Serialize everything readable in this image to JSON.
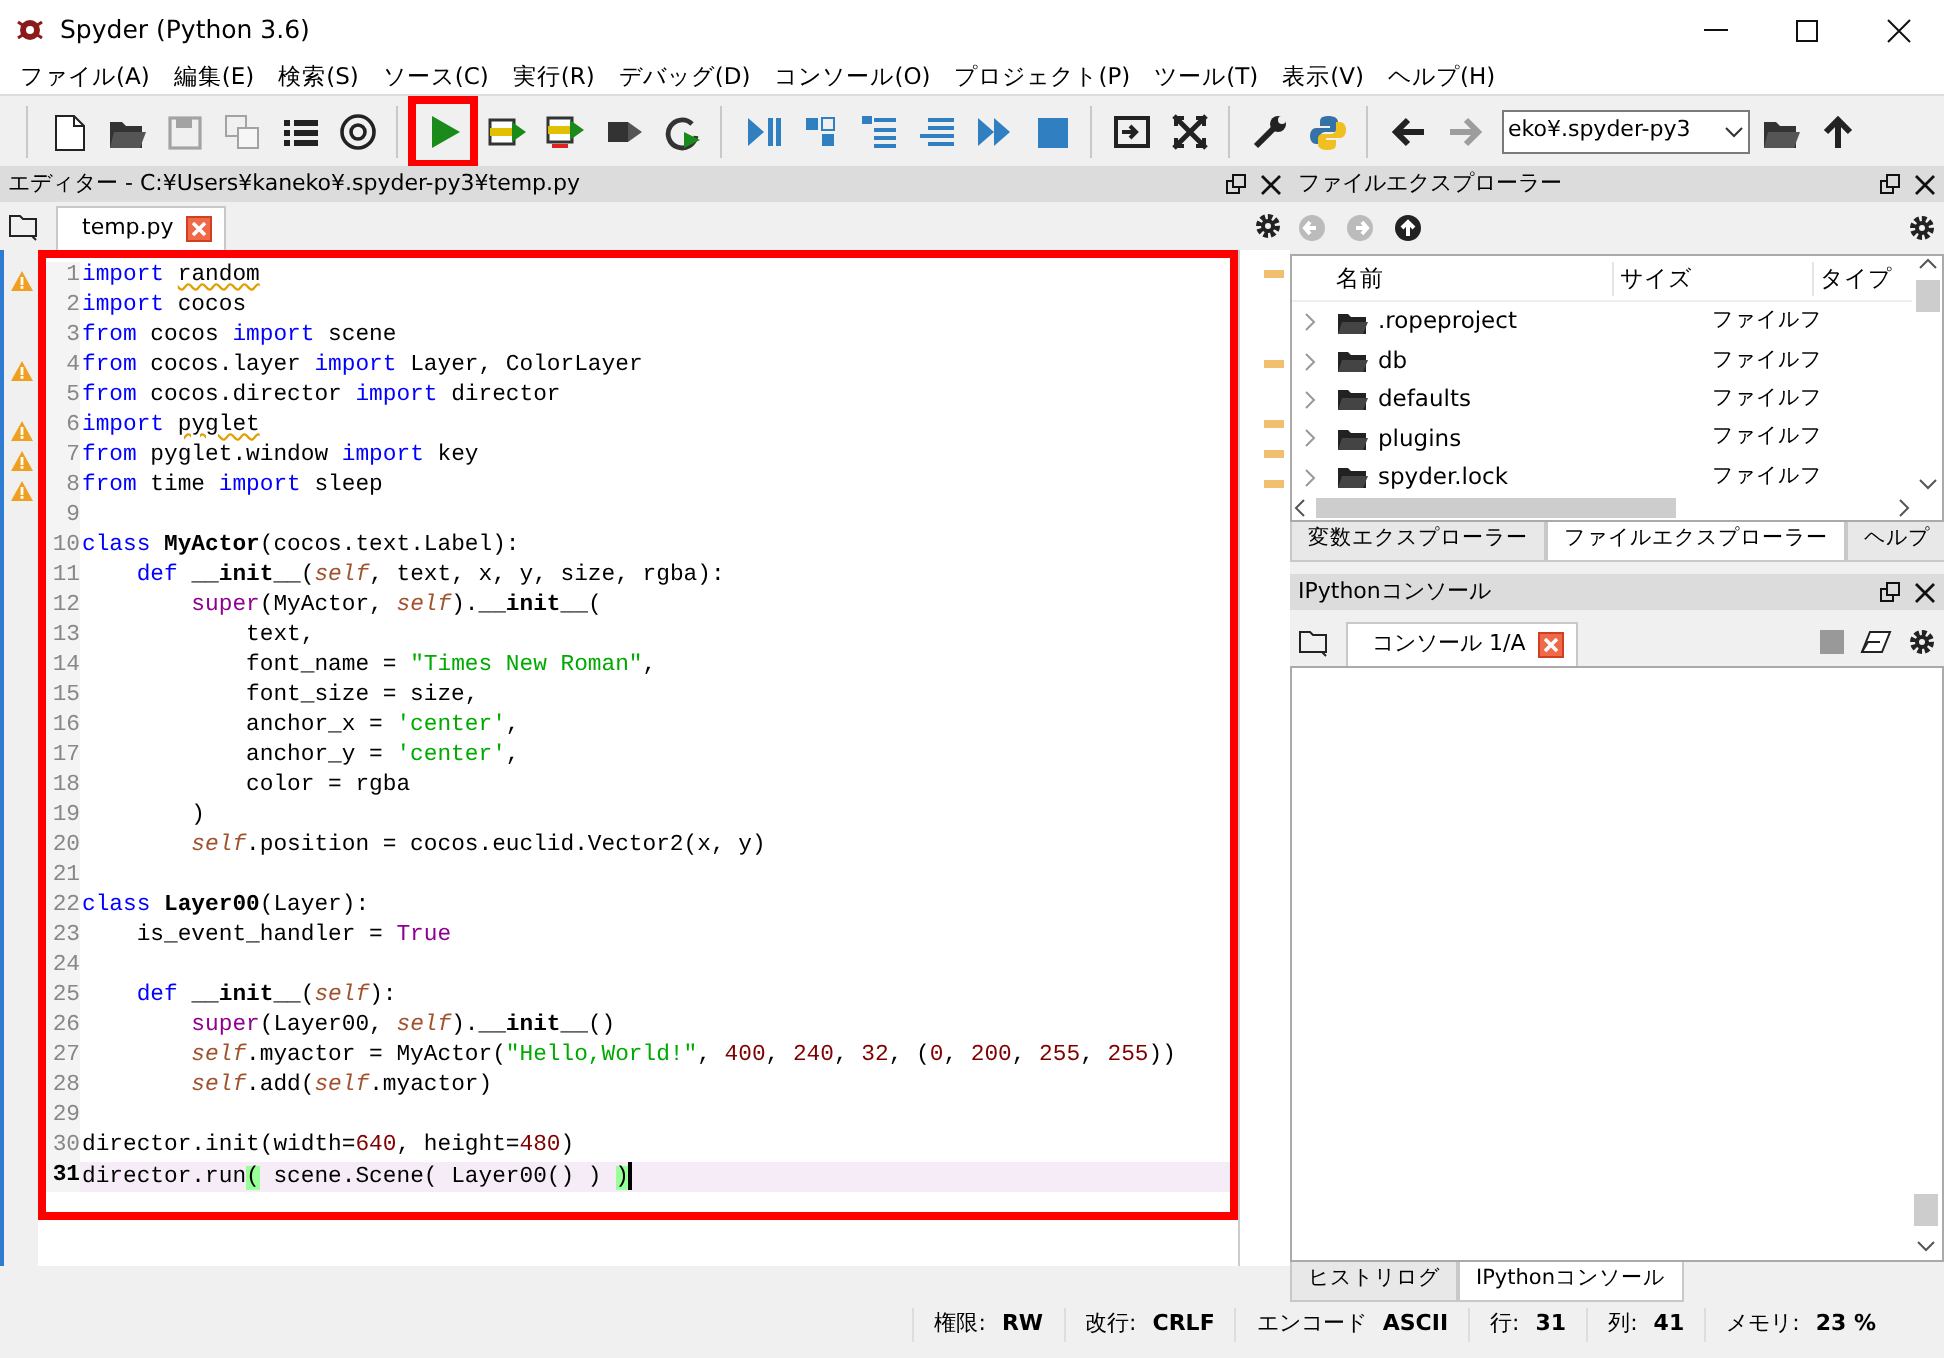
{
  "window": {
    "title": "Spyder (Python 3.6)"
  },
  "menu": [
    "ファイル(A)",
    "編集(E)",
    "検索(S)",
    "ソース(C)",
    "実行(R)",
    "デバッグ(D)",
    "コンソール(O)",
    "プロジェクト(P)",
    "ツール(T)",
    "表示(V)",
    "ヘルプ(H)"
  ],
  "toolbar": [
    [
      {
        "kind": "new-file",
        "disabled": false,
        "highlighted": false
      },
      {
        "kind": "open",
        "disabled": false,
        "highlighted": false
      },
      {
        "kind": "save",
        "disabled": true,
        "highlighted": false
      },
      {
        "kind": "save-all",
        "disabled": true,
        "highlighted": false
      },
      {
        "kind": "list",
        "disabled": false,
        "highlighted": false
      },
      {
        "kind": "at",
        "disabled": false,
        "highlighted": false
      }
    ],
    [
      {
        "kind": "run",
        "disabled": false,
        "highlighted": true
      },
      {
        "kind": "run-cell",
        "disabled": false,
        "highlighted": false
      },
      {
        "kind": "run-cell-advance",
        "disabled": false,
        "highlighted": false
      },
      {
        "kind": "run-selection",
        "disabled": false,
        "highlighted": false
      },
      {
        "kind": "rerun",
        "disabled": false,
        "highlighted": false
      }
    ],
    [
      {
        "kind": "debug",
        "disabled": false,
        "highlighted": false
      },
      {
        "kind": "step",
        "disabled": false,
        "highlighted": false
      },
      {
        "kind": "step-into",
        "disabled": false,
        "highlighted": false
      },
      {
        "kind": "step-return",
        "disabled": false,
        "highlighted": false
      },
      {
        "kind": "continue",
        "disabled": false,
        "highlighted": false
      },
      {
        "kind": "stop",
        "disabled": false,
        "highlighted": false
      }
    ],
    [
      {
        "kind": "maximize-pane",
        "disabled": false,
        "highlighted": false
      },
      {
        "kind": "fullscreen",
        "disabled": false,
        "highlighted": false
      }
    ],
    [
      {
        "kind": "wrench",
        "disabled": false,
        "highlighted": false
      },
      {
        "kind": "python",
        "disabled": false,
        "highlighted": false
      }
    ],
    [
      {
        "kind": "back",
        "disabled": false,
        "highlighted": false
      },
      {
        "kind": "forward",
        "disabled": true,
        "highlighted": false
      }
    ]
  ],
  "working_dir": {
    "value": "eko¥.spyder-py3"
  },
  "editor": {
    "title": "エディター - C:¥Users¥kaneko¥.spyder-py3¥temp.py",
    "tabs": [
      {
        "label": "temp.py",
        "selected": true
      }
    ],
    "highlighted": true,
    "lines": [
      {
        "number": "1",
        "warning": true,
        "current": false,
        "tokens": [
          {
            "kind": "keyword",
            "text": "import "
          },
          {
            "kind": "squiggle",
            "text": "random"
          }
        ]
      },
      {
        "number": "2",
        "warning": false,
        "current": false,
        "tokens": [
          {
            "kind": "keyword",
            "text": "import"
          },
          {
            "kind": "plain",
            "text": " cocos"
          }
        ]
      },
      {
        "number": "3",
        "warning": false,
        "current": false,
        "tokens": [
          {
            "kind": "keyword",
            "text": "from"
          },
          {
            "kind": "plain",
            "text": " cocos "
          },
          {
            "kind": "keyword",
            "text": "import"
          },
          {
            "kind": "plain",
            "text": " scene"
          }
        ]
      },
      {
        "number": "4",
        "warning": true,
        "current": false,
        "tokens": [
          {
            "kind": "keyword",
            "text": "from"
          },
          {
            "kind": "plain",
            "text": " cocos.layer "
          },
          {
            "kind": "keyword",
            "text": "import"
          },
          {
            "kind": "plain",
            "text": " Layer, ColorLayer"
          }
        ]
      },
      {
        "number": "5",
        "warning": false,
        "current": false,
        "tokens": [
          {
            "kind": "keyword",
            "text": "from"
          },
          {
            "kind": "plain",
            "text": " cocos.director "
          },
          {
            "kind": "keyword",
            "text": "import"
          },
          {
            "kind": "plain",
            "text": " director"
          }
        ]
      },
      {
        "number": "6",
        "warning": true,
        "current": false,
        "tokens": [
          {
            "kind": "keyword",
            "text": "import "
          },
          {
            "kind": "squiggle",
            "text": "pyglet"
          }
        ]
      },
      {
        "number": "7",
        "warning": true,
        "current": false,
        "tokens": [
          {
            "kind": "keyword",
            "text": "from"
          },
          {
            "kind": "plain",
            "text": " pyglet.window "
          },
          {
            "kind": "keyword",
            "text": "import"
          },
          {
            "kind": "plain",
            "text": " key"
          }
        ]
      },
      {
        "number": "8",
        "warning": true,
        "current": false,
        "tokens": [
          {
            "kind": "keyword",
            "text": "from"
          },
          {
            "kind": "plain",
            "text": " time "
          },
          {
            "kind": "keyword",
            "text": "import"
          },
          {
            "kind": "plain",
            "text": " sleep"
          }
        ]
      },
      {
        "number": "9",
        "warning": false,
        "current": false
      },
      {
        "number": "10",
        "warning": false,
        "current": false,
        "tokens": [
          {
            "kind": "keyword",
            "text": "class "
          },
          {
            "kind": "defname",
            "text": "MyActor"
          },
          {
            "kind": "plain",
            "text": "(cocos.text.Label):"
          }
        ]
      },
      {
        "number": "11",
        "warning": false,
        "current": false,
        "tokens": [
          {
            "kind": "keyword",
            "text": "    def "
          },
          {
            "kind": "defname",
            "text": "__init__"
          },
          {
            "kind": "plain",
            "text": "("
          },
          {
            "kind": "self",
            "text": "self"
          },
          {
            "kind": "plain",
            "text": ", text, x, y, size, rgba):"
          }
        ]
      },
      {
        "number": "12",
        "warning": false,
        "current": false,
        "tokens": [
          {
            "kind": "builtin",
            "text": "        super"
          },
          {
            "kind": "plain",
            "text": "(MyActor, "
          },
          {
            "kind": "self",
            "text": "self"
          },
          {
            "kind": "plain",
            "text": ")."
          },
          {
            "kind": "defname",
            "text": "__init__"
          },
          {
            "kind": "plain",
            "text": "("
          }
        ]
      },
      {
        "number": "13",
        "warning": false,
        "current": false,
        "tokens": [
          {
            "kind": "plain",
            "text": "            text,"
          }
        ]
      },
      {
        "number": "14",
        "warning": false,
        "current": false,
        "tokens": [
          {
            "kind": "plain",
            "text": "            font_name = "
          },
          {
            "kind": "string",
            "text": "\"Times New Roman\""
          },
          {
            "kind": "plain",
            "text": ","
          }
        ]
      },
      {
        "number": "15",
        "warning": false,
        "current": false,
        "tokens": [
          {
            "kind": "plain",
            "text": "            font_size = size,"
          }
        ]
      },
      {
        "number": "16",
        "warning": false,
        "current": false,
        "tokens": [
          {
            "kind": "plain",
            "text": "            anchor_x = "
          },
          {
            "kind": "string",
            "text": "'center'"
          },
          {
            "kind": "plain",
            "text": ","
          }
        ]
      },
      {
        "number": "17",
        "warning": false,
        "current": false,
        "tokens": [
          {
            "kind": "plain",
            "text": "            anchor_y = "
          },
          {
            "kind": "string",
            "text": "'center'"
          },
          {
            "kind": "plain",
            "text": ","
          }
        ]
      },
      {
        "number": "18",
        "warning": false,
        "current": false,
        "tokens": [
          {
            "kind": "plain",
            "text": "            color = rgba"
          }
        ]
      },
      {
        "number": "19",
        "warning": false,
        "current": false,
        "tokens": [
          {
            "kind": "plain",
            "text": "        )"
          }
        ]
      },
      {
        "number": "20",
        "warning": false,
        "current": false,
        "tokens": [
          {
            "kind": "self",
            "text": "        self"
          },
          {
            "kind": "plain",
            "text": ".position = cocos.euclid.Vector2(x, y)"
          }
        ]
      },
      {
        "number": "21",
        "warning": false,
        "current": false
      },
      {
        "number": "22",
        "warning": false,
        "current": false,
        "tokens": [
          {
            "kind": "keyword",
            "text": "class "
          },
          {
            "kind": "defname",
            "text": "Layer00"
          },
          {
            "kind": "plain",
            "text": "(Layer):"
          }
        ]
      },
      {
        "number": "23",
        "warning": false,
        "current": false,
        "tokens": [
          {
            "kind": "plain",
            "text": "    is_event_handler = "
          },
          {
            "kind": "builtin",
            "text": "True"
          }
        ]
      },
      {
        "number": "24",
        "warning": false,
        "current": false
      },
      {
        "number": "25",
        "warning": false,
        "current": false,
        "tokens": [
          {
            "kind": "keyword",
            "text": "    def "
          },
          {
            "kind": "defname",
            "text": "__init__"
          },
          {
            "kind": "plain",
            "text": "("
          },
          {
            "kind": "self",
            "text": "self"
          },
          {
            "kind": "plain",
            "text": "):"
          }
        ]
      },
      {
        "number": "26",
        "warning": false,
        "current": false,
        "tokens": [
          {
            "kind": "builtin",
            "text": "        super"
          },
          {
            "kind": "plain",
            "text": "(Layer00, "
          },
          {
            "kind": "self",
            "text": "self"
          },
          {
            "kind": "plain",
            "text": ")."
          },
          {
            "kind": "defname",
            "text": "__init__"
          },
          {
            "kind": "plain",
            "text": "()"
          }
        ]
      },
      {
        "number": "27",
        "warning": false,
        "current": false,
        "tokens": [
          {
            "kind": "self",
            "text": "        self"
          },
          {
            "kind": "plain",
            "text": ".myactor = MyActor("
          },
          {
            "kind": "string",
            "text": "\"Hello,World!\""
          },
          {
            "kind": "plain",
            "text": ", "
          },
          {
            "kind": "number",
            "text": "400"
          },
          {
            "kind": "plain",
            "text": ", "
          },
          {
            "kind": "number",
            "text": "240"
          },
          {
            "kind": "plain",
            "text": ", "
          },
          {
            "kind": "number",
            "text": "32"
          },
          {
            "kind": "plain",
            "text": ", ("
          },
          {
            "kind": "number",
            "text": "0"
          },
          {
            "kind": "plain",
            "text": ", "
          },
          {
            "kind": "number",
            "text": "200"
          },
          {
            "kind": "plain",
            "text": ", "
          },
          {
            "kind": "number",
            "text": "255"
          },
          {
            "kind": "plain",
            "text": ", "
          },
          {
            "kind": "number",
            "text": "255"
          },
          {
            "kind": "plain",
            "text": "))"
          }
        ]
      },
      {
        "number": "28",
        "warning": false,
        "current": false,
        "tokens": [
          {
            "kind": "self",
            "text": "        self"
          },
          {
            "kind": "plain",
            "text": ".add("
          },
          {
            "kind": "self",
            "text": "self"
          },
          {
            "kind": "plain",
            "text": ".myactor)"
          }
        ]
      },
      {
        "number": "29",
        "warning": false,
        "current": false
      },
      {
        "number": "30",
        "warning": false,
        "current": false,
        "tokens": [
          {
            "kind": "plain",
            "text": "director.init(width="
          },
          {
            "kind": "number",
            "text": "640"
          },
          {
            "kind": "plain",
            "text": ", height="
          },
          {
            "kind": "number",
            "text": "480"
          },
          {
            "kind": "plain",
            "text": ")"
          }
        ]
      },
      {
        "number": "31",
        "warning": false,
        "current": true,
        "tokens": [
          {
            "kind": "plain",
            "text": "director.run"
          },
          {
            "kind": "match",
            "text": "("
          },
          {
            "kind": "plain",
            "text": " scene.Scene( Layer00() ) "
          },
          {
            "kind": "match",
            "text": ")"
          }
        ]
      }
    ]
  },
  "file_explorer": {
    "title": "ファイルエクスプローラー",
    "columns": [
      "名前",
      "サイズ",
      "タイプ"
    ],
    "rows": [
      {
        "name": ".ropeproject",
        "type": "ファイルフ"
      },
      {
        "name": "db",
        "type": "ファイルフ"
      },
      {
        "name": "defaults",
        "type": "ファイルフ"
      },
      {
        "name": "plugins",
        "type": "ファイルフ"
      },
      {
        "name": "spyder.lock",
        "type": "ファイルフ"
      }
    ]
  },
  "upper_tabs": [
    {
      "label": "変数エクスプローラー",
      "selected": false
    },
    {
      "label": "ファイルエクスプローラー",
      "selected": true
    },
    {
      "label": "ヘルプ",
      "selected": false
    }
  ],
  "console": {
    "title": "IPythonコンソール",
    "tabs": [
      {
        "label": "コンソール 1/A",
        "selected": true
      }
    ]
  },
  "lower_tabs": [
    {
      "label": "ヒストリログ",
      "selected": false
    },
    {
      "label": "IPythonコンソール",
      "selected": true
    }
  ],
  "status_bar": [
    {
      "label": "権限:",
      "value": "RW"
    },
    {
      "label": "改行:",
      "value": "CRLF"
    },
    {
      "label": "エンコード",
      "value": "ASCII"
    },
    {
      "label": "行:",
      "value": "31"
    },
    {
      "label": "列:",
      "value": "41"
    },
    {
      "label": "メモリ:",
      "value": "23 %"
    }
  ]
}
